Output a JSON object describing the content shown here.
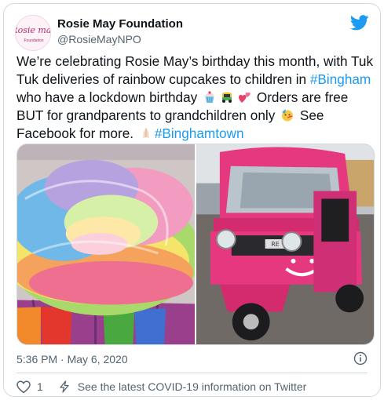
{
  "author": {
    "name": "Rosie May Foundation",
    "handle": "@RosieMayNPO",
    "avatar_text": "Rosie may",
    "avatar_sub": "Foundation"
  },
  "tweet": {
    "part1": "We’re celebrating Rosie May’s birthday this month, with Tuk Tuk deliveries of rainbow cupcakes to children in ",
    "hashtag1": "#Bingham",
    "part2": " who have a lockdown birthday ",
    "part3": " Orders are free BUT for grandparents to grandchildren only ",
    "part4": " See Facebook for more. ",
    "hashtag2": "#Binghamtown"
  },
  "media": {
    "plate_text": "RE"
  },
  "timestamp": "5:36 PM · May 6, 2020",
  "actions": {
    "like_count": "1",
    "covid_link": "See the latest COVID-19 information on Twitter"
  },
  "colors": {
    "link": "#1d9bf0",
    "tuk_pink": "#e6387f",
    "muted": "#536471"
  },
  "icons": [
    "twitter-bird-icon",
    "info-icon",
    "heart-icon",
    "lightning-bolt-icon"
  ]
}
